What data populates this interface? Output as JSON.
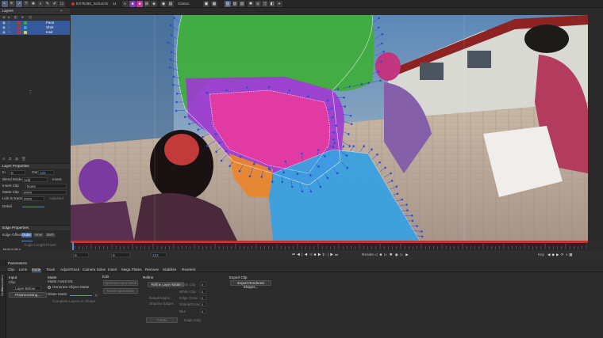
{
  "app": {
    "workspace": "Classic",
    "shot": "EX76188_School Bar",
    "frame_count": "11"
  },
  "layers": {
    "title": "Layers",
    "items": [
      {
        "label": "Face",
        "color": "#e63aa0"
      },
      {
        "label": "Shirt",
        "color": "#3aa0e0"
      },
      {
        "label": "Hair",
        "color": "#3fae3a"
      }
    ]
  },
  "layer_properties": {
    "title": "Layer Properties",
    "in_label": "In",
    "in_value": "0",
    "out_label": "Out",
    "out_value": "124",
    "blend_mode_label": "Blend Mode",
    "blend_mode_value": "Add",
    "invert_label": "Invert",
    "insert_clip_label": "Insert Clip",
    "insert_clip_value": "None",
    "matte_clip_label": "Matte Clip",
    "matte_clip_value": "####",
    "link_to_track_label": "Link to track",
    "link_to_track_value": "####",
    "adjusted_label": "Adjusted",
    "detail_label": "Detail"
  },
  "edge_properties": {
    "title": "Edge Properties",
    "edge_offset_label": "Edge Offset",
    "modes": [
      "Outer",
      "Inner",
      "Both"
    ],
    "active_mode": "Outer",
    "angle_label": "Angle",
    "length_label": "Length",
    "power_label": "Power",
    "motion_blur_label": "Motion Blur",
    "quality_label": "Quality"
  },
  "timeline": {
    "start": "0",
    "current": "0",
    "end": "124"
  },
  "playback": {
    "render_label": "Render",
    "key_label": "Key"
  },
  "tabs": [
    "Clip",
    "Lens",
    "Matte",
    "Track",
    "AdjustTrack",
    "Camera Solve",
    "Insert",
    "Mega Plates",
    "Remove",
    "Stabilize",
    "Reorient"
  ],
  "active_tab": "Matte",
  "params": {
    "title": "Parameters",
    "side_labels": [
      "Parameters",
      "Grade"
    ],
    "input": {
      "title": "Input",
      "clip_label": "Clip:",
      "layer_label": "Layer Below",
      "preprocessing_button": "Preprocessing..."
    },
    "matte": {
      "title": "Matte",
      "matte_assist_label": "Matte Assist ML",
      "generate_label": "Generate Object Matte",
      "dilate_label": "Dilate Matte",
      "dilate_value": "0",
      "complete_label": "Complete Layers in Shape"
    },
    "edit": {
      "title": "Edit",
      "buttons": [
        "Optimise Input Matte",
        "Reset Input Matte"
      ]
    },
    "refine": {
      "title": "Refine",
      "refine_button": "Refine Layer Matte",
      "detail_options": [
        "Detail Edges",
        "Shadow Edges"
      ],
      "create_button": "Create",
      "edge_only_label": "Edge Only",
      "sliders": [
        {
          "label": "Black Clip",
          "value": "0"
        },
        {
          "label": "White Clip",
          "value": "0"
        },
        {
          "label": "Edge Grow",
          "value": "0"
        },
        {
          "label": "Shrink/Grow",
          "value": "0"
        },
        {
          "label": "Blur",
          "value": "0"
        }
      ]
    },
    "export": {
      "title": "Export Clip",
      "button": "Export Rendered Shapes..."
    }
  },
  "colors": {
    "accent": "#4a6fb4",
    "hair_shape": "#3fae3a",
    "face_shape": "#e63aa0",
    "shirt_shape": "#3aa0e0",
    "orange_shape": "#e8862f",
    "purple_shape": "#a03ad0",
    "control_points": "#2f4bd6",
    "timeline_red": "#c23333"
  }
}
